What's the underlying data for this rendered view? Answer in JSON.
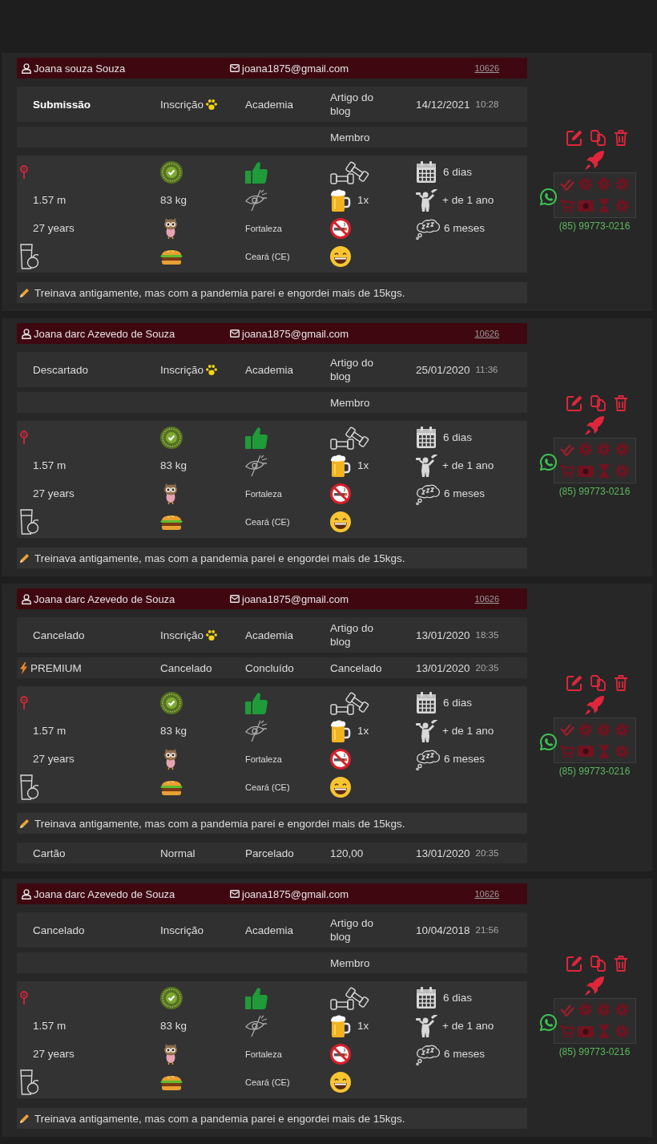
{
  "cards": [
    {
      "header": {
        "name": "Joana souza Souza",
        "email": "joana1875@gmail.com",
        "record_link": "10626"
      },
      "status_row": {
        "column_1": {
          "text": "Submissão",
          "bold": true
        },
        "column_2": {
          "text": "Inscrição",
          "paw": true
        },
        "column_3": "Academia",
        "column_4": "Artigo do blog",
        "date": "14/12/2021",
        "time": "10:28"
      },
      "second_row": {
        "column_4": "Membro"
      },
      "profile": {
        "height": "1.57 m",
        "weight": "83 kg",
        "age": "27 years",
        "city": "Fortaleza",
        "region": "Ceará (CE)",
        "beer": "1x",
        "days": "6 dias",
        "experience": "+ de 1 ano",
        "sleep": "6 meses"
      },
      "note": "Treinava antigamente, mas com a pandemia parei e engordei mais de 15kgs.",
      "phone": "(85) 99773-0216"
    },
    {
      "header": {
        "name": "Joana darc Azevedo de Souza",
        "email": "joana1875@gmail.com",
        "record_link": "10626"
      },
      "status_row": {
        "column_1": {
          "text": "Descartado",
          "bold": false
        },
        "column_2": {
          "text": "Inscrição",
          "paw": true
        },
        "column_3": "Academia",
        "column_4": "Artigo do blog",
        "date": "25/01/2020",
        "time": "11:36"
      },
      "second_row": {
        "column_4": "Membro"
      },
      "profile": {
        "height": "1.57 m",
        "weight": "83 kg",
        "age": "27 years",
        "city": "Fortaleza",
        "region": "Ceará (CE)",
        "beer": "1x",
        "days": "6 dias",
        "experience": "+ de 1 ano",
        "sleep": "6 meses"
      },
      "note": "Treinava antigamente, mas com a pandemia parei e engordei mais de 15kgs.",
      "phone": "(85) 99773-0216"
    },
    {
      "header": {
        "name": "Joana darc Azevedo de Souza",
        "email": "joana1875@gmail.com",
        "record_link": "10626"
      },
      "status_row": {
        "column_1": {
          "text": "Cancelado",
          "bold": false
        },
        "column_2": {
          "text": "Inscrição",
          "paw": true
        },
        "column_3": "Academia",
        "column_4": "Artigo do blog",
        "date": "13/01/2020",
        "time": "18:35"
      },
      "second_row": {
        "premium": true,
        "column_1": "PREMIUM",
        "column_2": "Cancelado",
        "column_3": "Concluído",
        "column_4": "Cancelado",
        "date": "13/01/2020",
        "time": "20:35"
      },
      "profile": {
        "height": "1.57 m",
        "weight": "83 kg",
        "age": "27 years",
        "city": "Fortaleza",
        "region": "Ceará (CE)",
        "beer": "1x",
        "days": "6 dias",
        "experience": "+ de 1 ano",
        "sleep": "6 meses"
      },
      "note": "Treinava antigamente, mas com a pandemia parei e engordei mais de 15kgs.",
      "payment_row": {
        "column_1": "Cartão",
        "column_2": "Normal",
        "column_3": "Parcelado",
        "column_4": "120,00",
        "date": "13/01/2020",
        "time": "20:35"
      },
      "phone": "(85) 99773-0216"
    },
    {
      "header": {
        "name": "Joana darc Azevedo de Souza",
        "email": "joana1875@gmail.com",
        "record_link": "10626"
      },
      "status_row": {
        "column_1": {
          "text": "Cancelado",
          "bold": false
        },
        "column_2": {
          "text": "Inscrição",
          "paw": false
        },
        "column_3": "Academia",
        "column_4": "Artigo do blog",
        "date": "10/04/2018",
        "time": "21:56"
      },
      "second_row": {
        "column_4": "Membro"
      },
      "profile": {
        "height": "1.57 m",
        "weight": "83 kg",
        "age": "27 years",
        "city": "Fortaleza",
        "region": "Ceará (CE)",
        "beer": "1x",
        "days": "6 dias",
        "experience": "+ de 1 ano",
        "sleep": "6 meses"
      },
      "note": "Treinava antigamente, mas com a pandemia parei e engordei mais de 15kgs.",
      "phone": "(85) 99773-0216"
    }
  ]
}
